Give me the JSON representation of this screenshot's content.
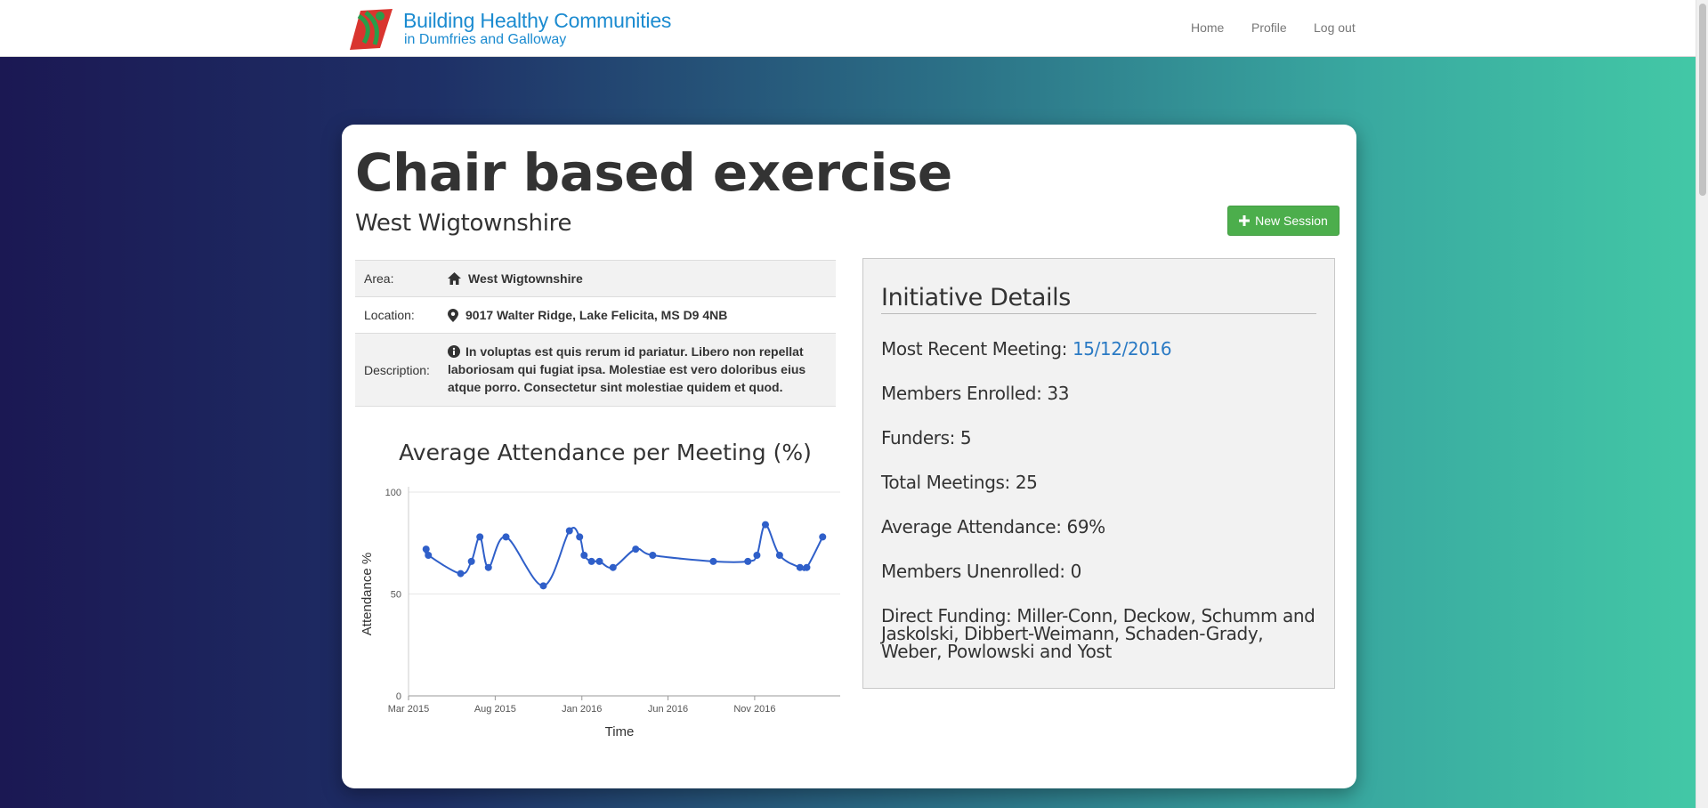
{
  "navbar": {
    "brand_line1": "Building Healthy Communities",
    "brand_line2": "in Dumfries and Galloway",
    "links": [
      "Home",
      "Profile",
      "Log out"
    ]
  },
  "page": {
    "title": "Chair based exercise",
    "subtitle": "West Wigtownshire",
    "new_session_label": "New Session"
  },
  "details": {
    "area_label": "Area:",
    "area_value": "West Wigtownshire",
    "location_label": "Location:",
    "location_value": "9017 Walter Ridge, Lake Felicita, MS D9 4NB",
    "description_label": "Description:",
    "description_value": "In voluptas est quis rerum id pariatur. Libero non repellat laboriosam qui fugiat ipsa. Molestiae est vero doloribus eius atque porro. Consectetur sint molestiae quidem et quod."
  },
  "initiative": {
    "heading": "Initiative Details",
    "recent_meeting_label": "Most Recent Meeting:",
    "recent_meeting_value": "15/12/2016",
    "members_enrolled": "Members Enrolled: 33",
    "funders": "Funders: 5",
    "total_meetings": "Total Meetings: 25",
    "average_attendance": "Average Attendance: 69%",
    "members_unenrolled": "Members Unenrolled: 0",
    "direct_funding": "Direct Funding: Miller-Conn, Deckow, Schumm and Jaskolski, Dibbert-Weimann, Schaden-Grady, Weber, Powlowski and Yost"
  },
  "colors": {
    "accent_green": "#4cae4c",
    "link_blue": "#2a7ac4",
    "chart_line": "#2f5fc9",
    "brand_blue": "#1b8bd0"
  },
  "chart_data": {
    "type": "line",
    "title": "Average Attendance per Meeting (%)",
    "xlabel": "Time",
    "ylabel": "Attendance %",
    "ylim": [
      0,
      100
    ],
    "yticks": [
      "0",
      "50",
      "100"
    ],
    "xlim": [
      "2015-03-01",
      "2017-04-01"
    ],
    "xticks": [
      {
        "date": "2015-03-01",
        "label": "Mar 2015"
      },
      {
        "date": "2015-08-01",
        "label": "Aug 2015"
      },
      {
        "date": "2016-01-01",
        "label": "Jan 2016"
      },
      {
        "date": "2016-06-01",
        "label": "Jun 2016"
      },
      {
        "date": "2016-11-01",
        "label": "Nov 2016"
      }
    ],
    "grid": true,
    "series": [
      {
        "points": [
          {
            "x": "2015-04-01",
            "y": 72
          },
          {
            "x": "2015-04-05",
            "y": 69
          },
          {
            "x": "2015-06-01",
            "y": 60
          },
          {
            "x": "2015-06-20",
            "y": 66
          },
          {
            "x": "2015-07-05",
            "y": 78
          },
          {
            "x": "2015-07-20",
            "y": 63
          },
          {
            "x": "2015-08-20",
            "y": 78
          },
          {
            "x": "2015-10-25",
            "y": 54
          },
          {
            "x": "2015-12-10",
            "y": 81
          },
          {
            "x": "2015-12-28",
            "y": 78
          },
          {
            "x": "2016-01-05",
            "y": 69
          },
          {
            "x": "2016-01-18",
            "y": 66
          },
          {
            "x": "2016-02-01",
            "y": 66
          },
          {
            "x": "2016-02-25",
            "y": 63
          },
          {
            "x": "2016-04-05",
            "y": 72
          },
          {
            "x": "2016-05-05",
            "y": 69
          },
          {
            "x": "2016-08-20",
            "y": 66
          },
          {
            "x": "2016-10-20",
            "y": 66
          },
          {
            "x": "2016-11-05",
            "y": 69
          },
          {
            "x": "2016-11-20",
            "y": 84
          },
          {
            "x": "2016-12-15",
            "y": 69
          },
          {
            "x": "2017-01-20",
            "y": 63
          },
          {
            "x": "2017-02-01",
            "y": 63
          },
          {
            "x": "2017-03-01",
            "y": 78
          }
        ]
      }
    ]
  }
}
